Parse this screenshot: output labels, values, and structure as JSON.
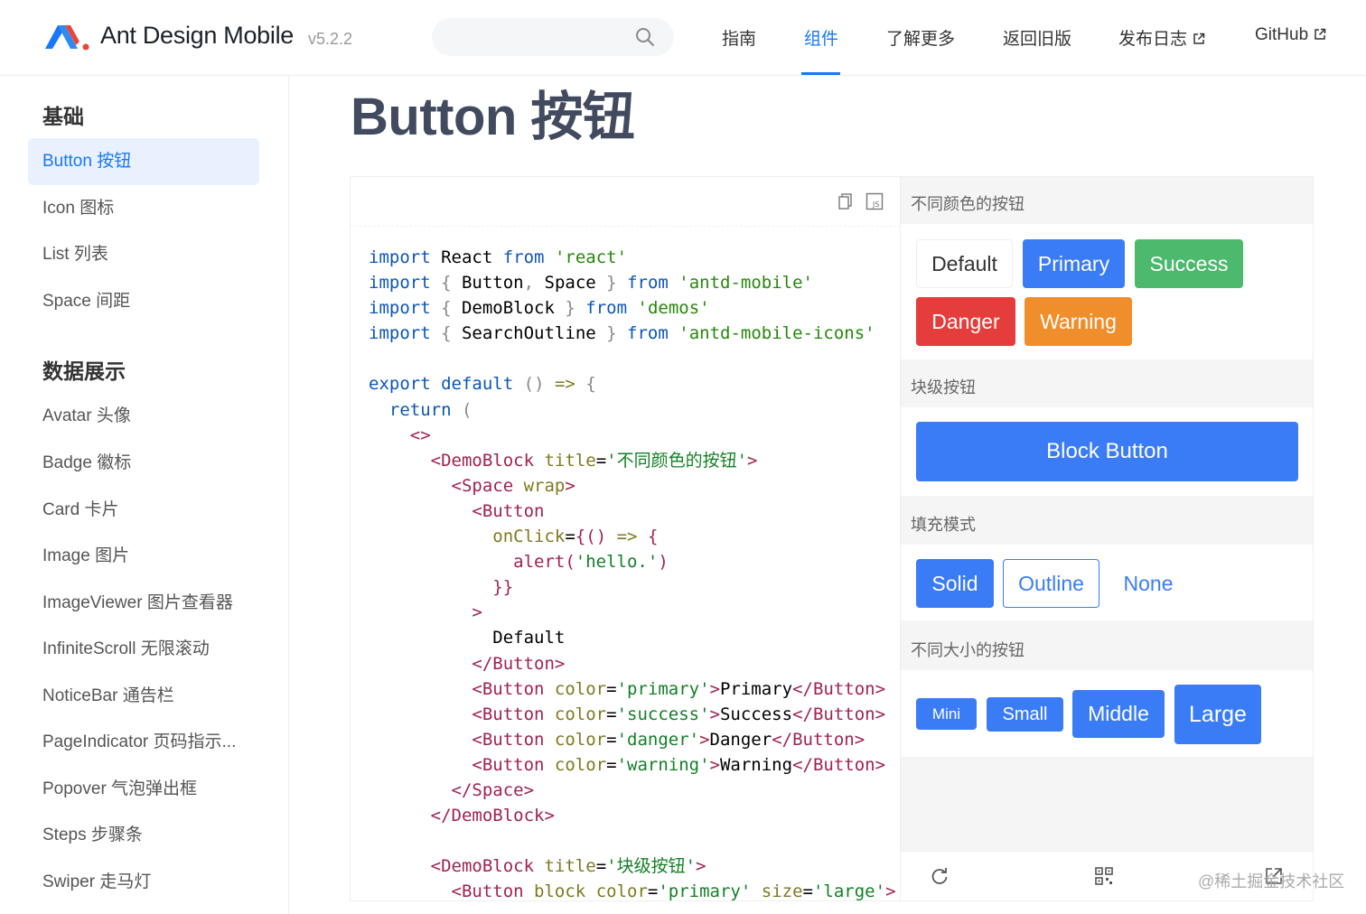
{
  "header": {
    "brand": "Ant Design Mobile",
    "version": "v5.2.2",
    "search_placeholder": "",
    "nav": [
      "指南",
      "组件",
      "了解更多",
      "返回旧版",
      "发布日志",
      "GitHub"
    ],
    "active_nav": "组件",
    "accent": "#1677ff"
  },
  "sidebar": {
    "groups": [
      {
        "title": "基础",
        "items": [
          "Button 按钮",
          "Icon 图标",
          "List 列表",
          "Space 间距"
        ]
      },
      {
        "title": "数据展示",
        "items": [
          "Avatar 头像",
          "Badge 徽标",
          "Card 卡片",
          "Image 图片",
          "ImageViewer 图片查看器",
          "InfiniteScroll 无限滚动",
          "NoticeBar 通告栏",
          "PageIndicator 页码指示...",
          "Popover 气泡弹出框",
          "Steps 步骤条",
          "Swiper 走马灯"
        ]
      }
    ],
    "active_item": "Button 按钮"
  },
  "page": {
    "title": "Button 按钮"
  },
  "preview": {
    "sections": [
      {
        "title": "不同颜色的按钮",
        "buttons": [
          "Default",
          "Primary",
          "Success",
          "Danger",
          "Warning"
        ]
      },
      {
        "title": "块级按钮",
        "buttons": [
          "Block Button"
        ]
      },
      {
        "title": "填充模式",
        "buttons": [
          "Solid",
          "Outline",
          "None"
        ]
      },
      {
        "title": "不同大小的按钮",
        "buttons": [
          "Mini",
          "Small",
          "Middle",
          "Large"
        ]
      }
    ],
    "colors": {
      "primary": "#3a7cf6",
      "success": "#4cb96c",
      "danger": "#e43d3b",
      "warning": "#ef8e2b"
    }
  },
  "watermark": "@稀土掘金技术社区"
}
